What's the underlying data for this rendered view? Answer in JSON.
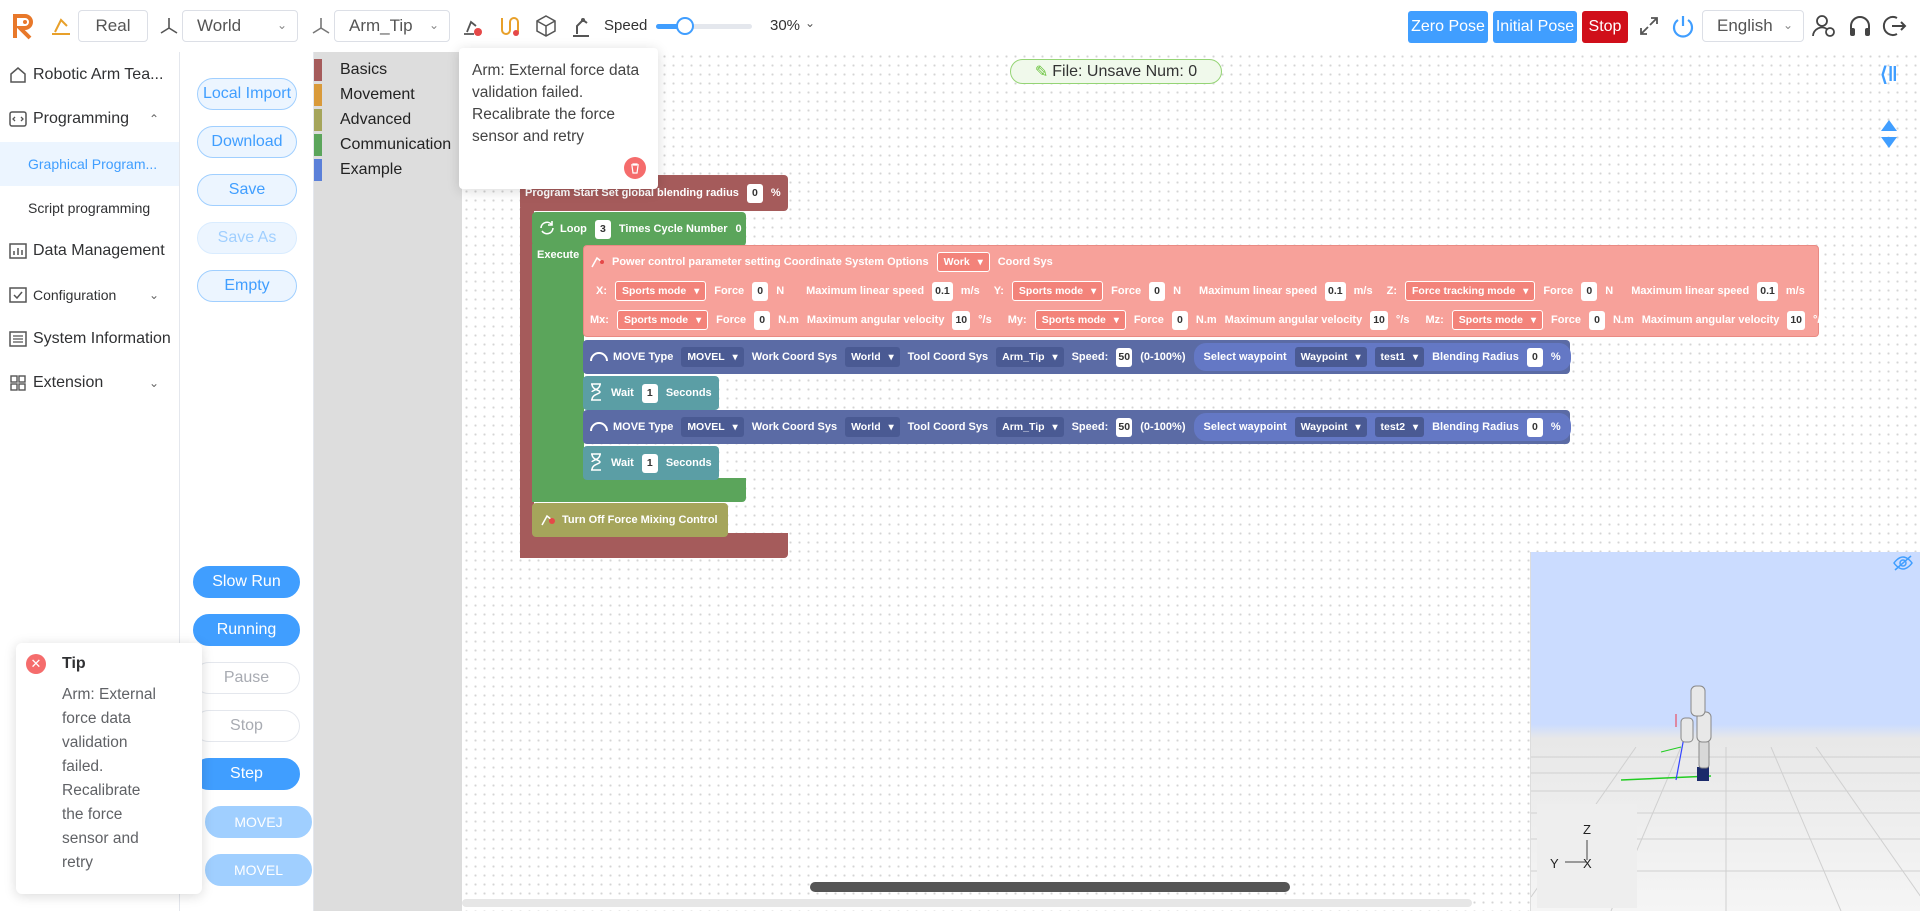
{
  "topbar": {
    "mode_select": "Real",
    "coord_select": "World",
    "tool_select": "Arm_Tip",
    "speed_label": "Speed",
    "speed_value": "30%",
    "speed_fraction": 0.3,
    "zero_pose": "Zero Pose",
    "initial_pose": "Initial Pose",
    "stop": "Stop",
    "language": "English",
    "colors": {
      "blue": "#409eff",
      "red": "#d00f1a"
    }
  },
  "nav": {
    "home": "Robotic Arm Tea...",
    "programming": "Programming",
    "graphical": "Graphical Program...",
    "script": "Script programming",
    "data": "Data Management",
    "configuration": "Configuration",
    "system": "System Information",
    "extension": "Extension"
  },
  "files": {
    "local_import": "Local Import",
    "download": "Download",
    "save": "Save",
    "save_as": "Save As",
    "empty": "Empty"
  },
  "run": {
    "slow_run": "Slow Run",
    "running": "Running",
    "pause": "Pause",
    "stop": "Stop",
    "step": "Step",
    "movej": "MOVEJ",
    "movel": "MOVEL"
  },
  "categories": [
    {
      "label": "Basics",
      "color": "#a55b5b"
    },
    {
      "label": "Movement",
      "color": "#d99a3a"
    },
    {
      "label": "Advanced",
      "color": "#a5a55b"
    },
    {
      "label": "Communication",
      "color": "#5ba55b"
    },
    {
      "label": "Example",
      "color": "#5b80d9"
    }
  ],
  "file_badge": "File:  Unsave  Num:  0",
  "tooltip": "Arm: External force data validation failed. Recalibrate the force sensor and retry",
  "tip": {
    "title": "Tip",
    "message": "Arm: External force data validation failed. Recalibrate the force sensor and retry"
  },
  "blocks": {
    "start": {
      "label": "Program Start  Set global blending radius",
      "value": "0",
      "unit": "%"
    },
    "loop": {
      "label": "Loop",
      "times": "3",
      "after": "Times Cycle Number",
      "cycle": "0",
      "execute": "Execute"
    },
    "force": {
      "title": "Power control parameter setting  Coordinate System Options",
      "coord": "Work",
      "coord_after": "Coord Sys",
      "x_label": "X:",
      "x_mode": "Sports mode",
      "x_force": "0",
      "x_speed": "0.1",
      "y_label": "Y:",
      "y_mode": "Sports mode",
      "y_force": "0",
      "y_speed": "0.1",
      "z_label": "Z:",
      "z_mode": "Force tracking mode",
      "z_force": "0",
      "z_speed": "0.1",
      "mx_label": "Mx:",
      "mx_mode": "Sports mode",
      "mx_force": "0",
      "mx_vel": "10",
      "my_label": "My:",
      "my_mode": "Sports mode",
      "my_force": "0",
      "my_vel": "10",
      "mz_label": "Mz:",
      "mz_mode": "Sports mode",
      "mz_force": "0",
      "mz_vel": "10",
      "force_label": "Force",
      "n_unit": "N",
      "nm_unit": "N.m",
      "lin_label": "Maximum linear speed",
      "lin_unit": "m/s",
      "ang_label": "Maximum angular velocity",
      "ang_unit": "°/s"
    },
    "move1": {
      "type_label": "MOVE Type",
      "type": "MOVEL",
      "work_label": "Work Coord Sys",
      "work": "World",
      "tool_label": "Tool Coord Sys",
      "tool": "Arm_Tip",
      "speed_label": "Speed:",
      "speed": "50",
      "range": "(0-100%)",
      "wp_label": "Select waypoint",
      "wp_type": "Waypoint",
      "wp": "test1",
      "blend_label": "Blending Radius",
      "blend": "0",
      "pct": "%"
    },
    "wait1": {
      "label": "Wait",
      "value": "1",
      "unit": "Seconds"
    },
    "move2": {
      "type_label": "MOVE Type",
      "type": "MOVEL",
      "work_label": "Work Coord Sys",
      "work": "World",
      "tool_label": "Tool Coord Sys",
      "tool": "Arm_Tip",
      "speed_label": "Speed:",
      "speed": "50",
      "range": "(0-100%)",
      "wp_label": "Select waypoint",
      "wp_type": "Waypoint",
      "wp": "test2",
      "blend_label": "Blending Radius",
      "blend": "0",
      "pct": "%"
    },
    "wait2": {
      "label": "Wait",
      "value": "1",
      "unit": "Seconds"
    },
    "turnoff": {
      "label": "Turn Off Force Mixing Control"
    }
  },
  "viewer": {
    "axis_z": "Z",
    "axis_y": "Y",
    "axis_x": "X"
  }
}
